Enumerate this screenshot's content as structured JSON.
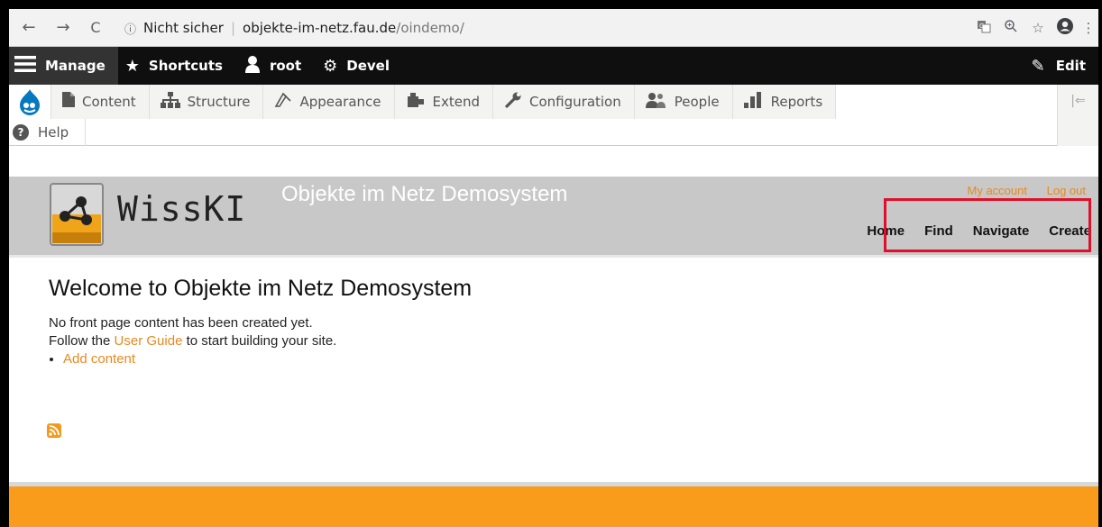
{
  "browser": {
    "back_icon": "←",
    "forward_icon": "→",
    "reload_icon": "C",
    "info_icon": "ⓘ",
    "security_label": "Nicht sicher",
    "url_host": "objekte-im-netz.fau.de",
    "url_path": "/oindemo/",
    "right_icons": [
      "translate-icon",
      "zoom-icon",
      "star-icon",
      "account-icon",
      "menu-icon"
    ]
  },
  "toolbar": {
    "manage": "Manage",
    "shortcuts": "Shortcuts",
    "user": "root",
    "devel": "Devel",
    "edit": "Edit"
  },
  "admin_menu": {
    "items": [
      {
        "label": "Content",
        "icon": "content-icon"
      },
      {
        "label": "Structure",
        "icon": "structure-icon"
      },
      {
        "label": "Appearance",
        "icon": "appearance-icon"
      },
      {
        "label": "Extend",
        "icon": "extend-icon"
      },
      {
        "label": "Configuration",
        "icon": "configuration-icon"
      },
      {
        "label": "People",
        "icon": "people-icon"
      },
      {
        "label": "Reports",
        "icon": "reports-icon"
      }
    ],
    "help": "Help"
  },
  "site": {
    "logo_text": "WissKI",
    "slogan": "Objekte im Netz Demosystem",
    "secondary_links": [
      "My account",
      "Log out"
    ],
    "main_nav": [
      "Home",
      "Find",
      "Navigate",
      "Create"
    ]
  },
  "content": {
    "title": "Welcome to Objekte im Netz Demosystem",
    "line1": "No front page content has been created yet.",
    "line2_pre": "Follow the ",
    "line2_link": "User Guide",
    "line2_post": " to start building your site.",
    "add_content": "Add content"
  },
  "colors": {
    "accent": "#e8891e",
    "footer": "#fa9c1b",
    "highlight_box": "#e0102a"
  }
}
